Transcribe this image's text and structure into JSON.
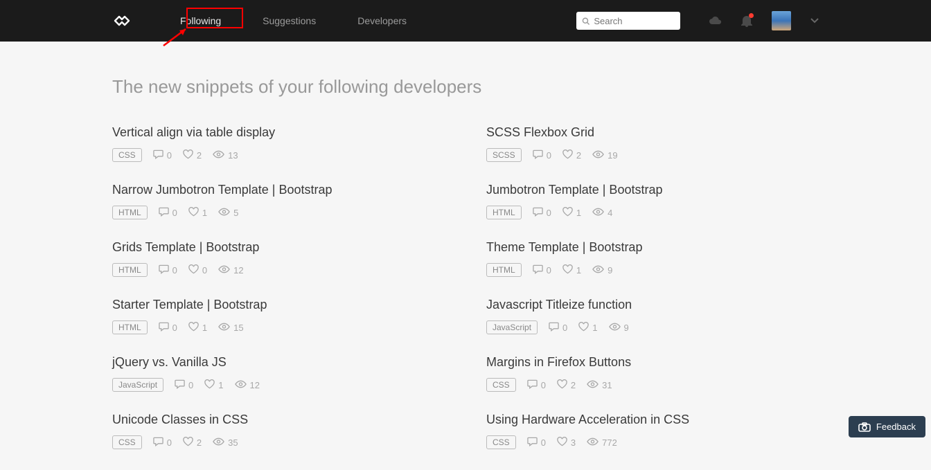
{
  "nav": {
    "following": "Following",
    "suggestions": "Suggestions",
    "developers": "Developers"
  },
  "search": {
    "placeholder": "Search"
  },
  "page_title": "The new snippets of your following developers",
  "left": [
    {
      "title": "Vertical align via table display",
      "tag": "CSS",
      "comments": 0,
      "likes": 2,
      "views": 13
    },
    {
      "title": "Narrow Jumbotron Template | Bootstrap",
      "tag": "HTML",
      "comments": 0,
      "likes": 1,
      "views": 5
    },
    {
      "title": "Grids Template | Bootstrap",
      "tag": "HTML",
      "comments": 0,
      "likes": 0,
      "views": 12
    },
    {
      "title": "Starter Template | Bootstrap",
      "tag": "HTML",
      "comments": 0,
      "likes": 1,
      "views": 15
    },
    {
      "title": "jQuery vs. Vanilla JS",
      "tag": "JavaScript",
      "comments": 0,
      "likes": 1,
      "views": 12
    },
    {
      "title": "Unicode Classes in CSS",
      "tag": "CSS",
      "comments": 0,
      "likes": 2,
      "views": 35
    }
  ],
  "right": [
    {
      "title": "SCSS Flexbox Grid",
      "tag": "SCSS",
      "comments": 0,
      "likes": 2,
      "views": 19
    },
    {
      "title": "Jumbotron Template | Bootstrap",
      "tag": "HTML",
      "comments": 0,
      "likes": 1,
      "views": 4
    },
    {
      "title": "Theme Template | Bootstrap",
      "tag": "HTML",
      "comments": 0,
      "likes": 1,
      "views": 9
    },
    {
      "title": "Javascript Titleize function",
      "tag": "JavaScript",
      "comments": 0,
      "likes": 1,
      "views": 9
    },
    {
      "title": "Margins in Firefox Buttons",
      "tag": "CSS",
      "comments": 0,
      "likes": 2,
      "views": 31
    },
    {
      "title": "Using Hardware Acceleration in CSS",
      "tag": "CSS",
      "comments": 0,
      "likes": 3,
      "views": 772
    }
  ],
  "feedback": {
    "label": "Feedback"
  }
}
